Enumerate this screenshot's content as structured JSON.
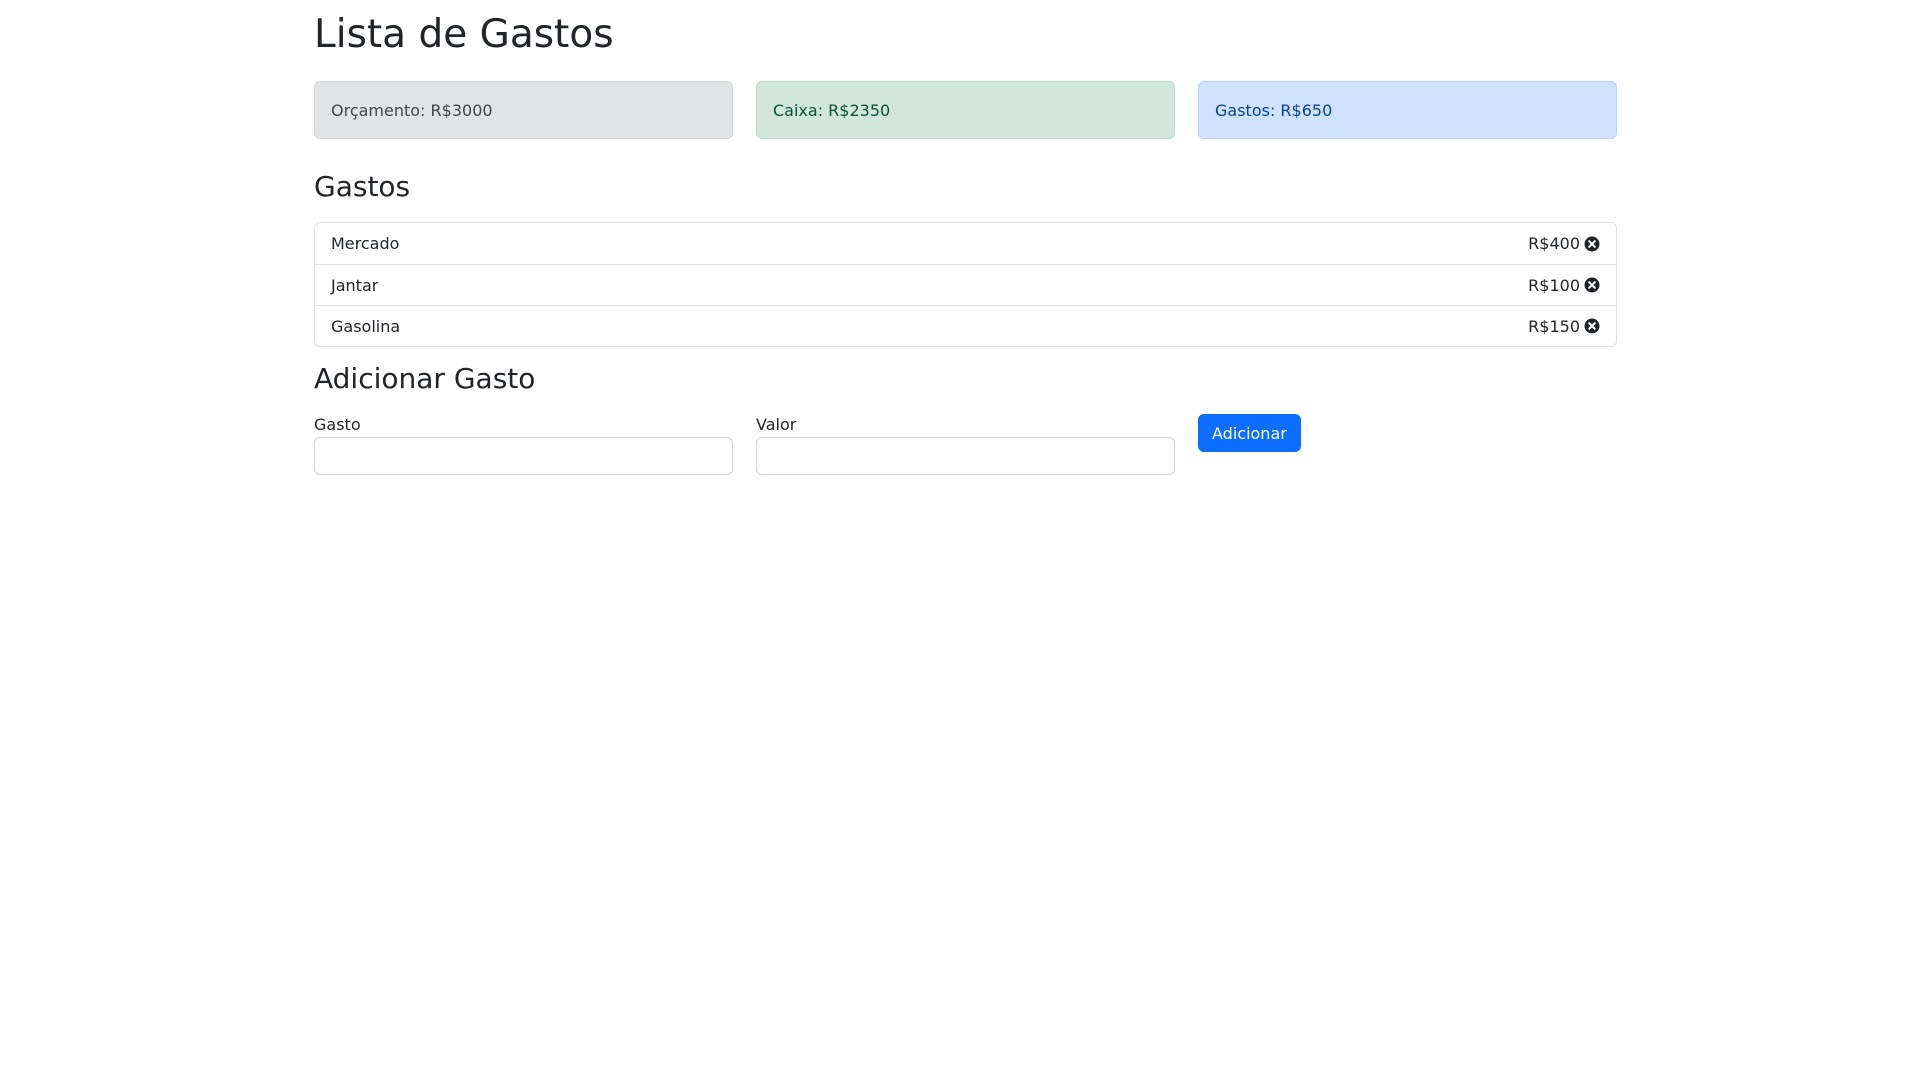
{
  "page": {
    "title": "Lista de Gastos"
  },
  "summary": {
    "budget": "Orçamento: R$3000",
    "remaining": "Caixa: R$2350",
    "spent": "Gastos: R$650"
  },
  "expenses": {
    "heading": "Gastos",
    "items": [
      {
        "name": "Mercado",
        "value": "R$400"
      },
      {
        "name": "Jantar",
        "value": "R$100"
      },
      {
        "name": "Gasolina",
        "value": "R$150"
      }
    ]
  },
  "add_form": {
    "heading": "Adicionar Gasto",
    "name_label": "Gasto",
    "name_value": "",
    "value_label": "Valor",
    "value_value": "",
    "submit_label": "Adicionar"
  },
  "icons": {
    "delete": "close-circle-icon"
  },
  "colors": {
    "primary": "#0d6efd",
    "secondary_bg": "#e2e3e5",
    "success_bg": "#d1e7dd",
    "primary_bg": "#cfe2ff"
  }
}
